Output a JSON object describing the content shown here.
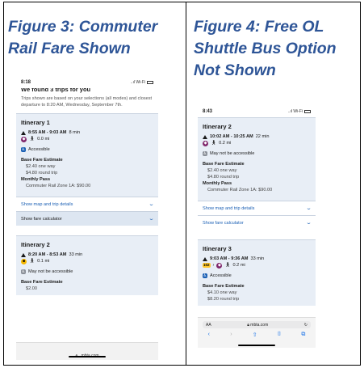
{
  "figure3": {
    "title": "Figure 3: Commuter Rail Fare Shown",
    "phone": {
      "time": "8:18",
      "signal": "..ıl Wi-Fi",
      "heading": "We found 3 trips for you",
      "intro": "Trips shown are based on your selections (all modes) and closest departure to 8:20 AM, Wednesday, September 7th.",
      "itinerary1": {
        "title": "Itinerary 1",
        "times": "8:55 AM - 9:03 AM",
        "duration": "8 min",
        "walk": "0.0 mi",
        "accessible": "Accessible",
        "base_fare_label": "Base Fare Estimate",
        "one_way": "$2.40 one way",
        "round_trip": "$4.80 round trip",
        "monthly_label": "Monthly Pass",
        "monthly_value": "Commuter Rail Zone 1A: $90.00"
      },
      "show_map": "Show map and trip details",
      "show_fare": "Show fare calculator",
      "itinerary2": {
        "title": "Itinerary 2",
        "times": "8:20 AM - 8:53 AM",
        "duration": "33 min",
        "walk": "0.1 mi",
        "accessible": "May not be accessible",
        "base_fare_label": "Base Fare Estimate",
        "cut": "$2.00"
      },
      "url": "mbta.com"
    }
  },
  "figure4": {
    "title": "Figure 4: Free OL Shuttle Bus Option Not Shown",
    "phone": {
      "time": "8:43",
      "signal": "..ıl Wi-Fi",
      "itinerary2": {
        "title": "Itinerary 2",
        "times": "10:02 AM - 10:25 AM",
        "duration": "22 min",
        "walk": "0.2 mi",
        "accessible": "May not be accessible",
        "base_fare_label": "Base Fare Estimate",
        "one_way": "$2.40 one way",
        "round_trip": "$4.80 round trip",
        "monthly_label": "Monthly Pass",
        "monthly_value": "Commuter Rail Zone 1A: $90.00"
      },
      "show_map": "Show map and trip details",
      "show_fare": "Show fare calculator",
      "itinerary3": {
        "title": "Itinerary 3",
        "times": "9:03 AM - 9:36 AM",
        "duration": "33 min",
        "route": "102",
        "walk": "0.2 mi",
        "accessible": "Accessible",
        "base_fare_label": "Base Fare Estimate",
        "one_way": "$4.10 one way",
        "cut": "$8.20 round trip"
      },
      "safari": {
        "aa": "AA",
        "url": "mbta.com",
        "reload": "↻",
        "nav": [
          "‹",
          "›",
          "⇧",
          "⌷",
          "⧉"
        ]
      }
    }
  },
  "colors": {
    "title_blue": "#2e5597",
    "commuter_rail": "#80276c",
    "bus_yellow": "#f5b700",
    "card_bg": "#e8eef6",
    "link_blue": "#1a5fb4"
  },
  "icons": [
    "walk-triangle-icon",
    "commuter-rail-icon",
    "bus-icon",
    "accessible-icon",
    "not-accessible-icon",
    "chevron-down-icon",
    "lock-icon",
    "reload-icon",
    "back-icon",
    "forward-icon",
    "share-icon",
    "bookmarks-icon",
    "tabs-icon"
  ]
}
